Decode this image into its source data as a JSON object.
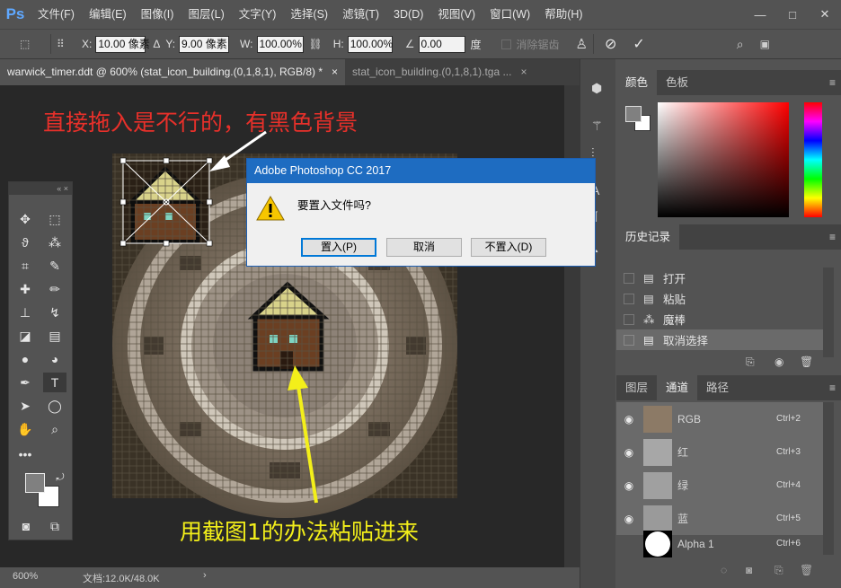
{
  "app": {
    "logo": "Ps"
  },
  "menubar": [
    "文件(F)",
    "编辑(E)",
    "图像(I)",
    "图层(L)",
    "文字(Y)",
    "选择(S)",
    "滤镜(T)",
    "3D(D)",
    "视图(V)",
    "窗口(W)",
    "帮助(H)"
  ],
  "window_controls": {
    "minimize": "—",
    "maximize": "□",
    "close": "✕"
  },
  "options": {
    "x_label": "X:",
    "x_value": "10.00 像素",
    "y_label": "Y:",
    "y_value": "9.00 像素",
    "w_label": "W:",
    "w_value": "100.00%",
    "h_label": "H:",
    "h_value": "100.00%",
    "angle_value": "0.00",
    "angle_unit": "度",
    "antialias_label": "消除锯齿"
  },
  "tabs": [
    {
      "label": "warwick_timer.ddt @ 600% (stat_icon_building.(0,1,8,1), RGB/8) *",
      "close": "×"
    },
    {
      "label": "stat_icon_building.(0,1,8,1).tga ...",
      "close": "×"
    }
  ],
  "annotations": {
    "top": "直接拖入是不行的，有黑色背景",
    "bottom": "用截图1的办法粘贴进来"
  },
  "dialog": {
    "title": "Adobe Photoshop CC 2017",
    "message": "要置入文件吗?",
    "buttons": {
      "place": "置入(P)",
      "cancel": "取消",
      "dont_place": "不置入(D)"
    }
  },
  "color_panel": {
    "tabs": [
      "颜色",
      "色板"
    ],
    "fg": "#808080",
    "bg": "#ffffff"
  },
  "history_panel": {
    "tab": "历史记录",
    "items": [
      {
        "label": "打开",
        "icon": "document-icon"
      },
      {
        "label": "粘贴",
        "icon": "document-icon"
      },
      {
        "label": "魔棒",
        "icon": "magic-wand-icon"
      },
      {
        "label": "取消选择",
        "icon": "document-icon"
      }
    ]
  },
  "channels_panel": {
    "tabs": [
      "图层",
      "通道",
      "路径"
    ],
    "channels": [
      {
        "name": "RGB",
        "shortcut": "Ctrl+2"
      },
      {
        "name": "红",
        "shortcut": "Ctrl+3"
      },
      {
        "name": "绿",
        "shortcut": "Ctrl+4"
      },
      {
        "name": "蓝",
        "shortcut": "Ctrl+5"
      },
      {
        "name": "Alpha 1",
        "shortcut": "Ctrl+6"
      }
    ]
  },
  "status": {
    "zoom": "600%",
    "doc": "文档:12.0K/48.0K",
    "arrow": "›"
  },
  "colors": {
    "accent_blue": "#1e6cc1",
    "annot_red": "#e8302a",
    "annot_yellow": "#f3ef1a"
  }
}
